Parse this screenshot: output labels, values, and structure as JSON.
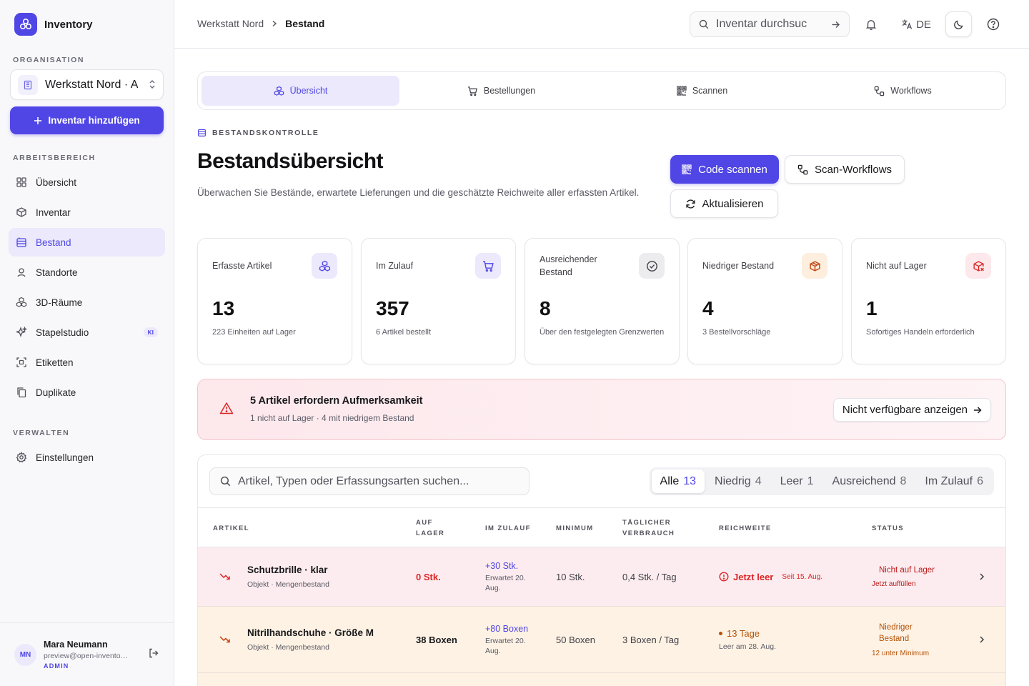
{
  "colors": {
    "accent": "#5046e5",
    "danger": "#dc2626",
    "warning": "#b45309"
  },
  "sidebar": {
    "app_name": "Inventory",
    "org_section": "ORGANISATION",
    "org_name": "Werkstatt Nord · A",
    "add_button": "Inventar hinzufügen",
    "workspace_section": "ARBEITSBEREICH",
    "workspace_items": [
      {
        "label": "Übersicht",
        "icon": "grid-icon"
      },
      {
        "label": "Inventar",
        "icon": "box-icon"
      },
      {
        "label": "Bestand",
        "icon": "stack-icon",
        "active": true
      },
      {
        "label": "Standorte",
        "icon": "location-pin-icon"
      },
      {
        "label": "3D-Räume",
        "icon": "cubes-icon"
      },
      {
        "label": "Stapelstudio",
        "icon": "sparkle-icon",
        "badge": "KI"
      },
      {
        "label": "Etiketten",
        "icon": "scan-frame-icon"
      },
      {
        "label": "Duplikate",
        "icon": "copy-icon"
      }
    ],
    "manage_section": "VERWALTEN",
    "manage_items": [
      {
        "label": "Einstellungen",
        "icon": "gear-icon"
      }
    ],
    "user": {
      "initials": "MN",
      "name": "Mara Neumann",
      "email": "preview@open-inventory.app",
      "role": "ADMIN"
    }
  },
  "header": {
    "breadcrumb": [
      "Werkstatt Nord",
      "Bestand"
    ],
    "search_placeholder": "Inventar durchsuc",
    "language": "DE"
  },
  "tabs": [
    {
      "label": "Übersicht",
      "icon": "cubes-icon",
      "active": true
    },
    {
      "label": "Bestellungen",
      "icon": "cart-icon"
    },
    {
      "label": "Scannen",
      "icon": "qr-code-icon"
    },
    {
      "label": "Workflows",
      "icon": "workflow-icon"
    }
  ],
  "page": {
    "eyebrow": "BESTANDSKONTROLLE",
    "title": "Bestandsübersicht",
    "description": "Überwachen Sie Bestände, erwartete Lieferungen und die geschätzte Reichweite aller erfassten Artikel.",
    "actions": {
      "scan": "Code scannen",
      "workflows": "Scan-Workflows",
      "refresh": "Aktualisieren"
    }
  },
  "stats": [
    {
      "label": "Erfasste Artikel",
      "value": "13",
      "sub": "223 Einheiten auf Lager",
      "icon": "cubes-icon"
    },
    {
      "label": "Im Zulauf",
      "value": "357",
      "sub": "6 Artikel bestellt",
      "icon": "cart-icon"
    },
    {
      "label": "Ausreichender Bestand",
      "value": "8",
      "sub": "Über den festgelegten Grenzwerten",
      "icon": "check-circle-icon"
    },
    {
      "label": "Niedriger Bestand",
      "value": "4",
      "sub": "3 Bestellvorschläge",
      "icon": "package-icon"
    },
    {
      "label": "Nicht auf Lager",
      "value": "1",
      "sub": "Sofortiges Handeln erforderlich",
      "icon": "package-x-icon"
    }
  ],
  "alert": {
    "title": "5 Artikel erfordern Aufmerksamkeit",
    "subtitle": "1 nicht auf Lager · 4 mit niedrigem Bestand",
    "button": "Nicht verfügbare anzeigen"
  },
  "table": {
    "search_placeholder": "Artikel, Typen oder Erfassungsarten suchen...",
    "filters": [
      {
        "label": "Alle",
        "count": "13",
        "active": true
      },
      {
        "label": "Niedrig",
        "count": "4"
      },
      {
        "label": "Leer",
        "count": "1"
      },
      {
        "label": "Ausreichend",
        "count": "8"
      },
      {
        "label": "Im Zulauf",
        "count": "6"
      }
    ],
    "columns": {
      "item": "ARTIKEL",
      "on_hand_1": "AUF",
      "on_hand_2": "LAGER",
      "incoming": "IM ZULAUF",
      "minimum": "MINIMUM",
      "daily_1": "TÄGLICHER",
      "daily_2": "VERBRAUCH",
      "reach": "REICHWEITE",
      "status": "STATUS"
    },
    "rows": [
      {
        "name": "Schutzbrille · klar",
        "meta": "Objekt · Mengenbestand",
        "on_hand": "0 Stk.",
        "incoming": "+30 Stk.",
        "incoming_date": "Erwartet 20. Aug.",
        "minimum": "10 Stk.",
        "daily": "0,4 Stk. / Tag",
        "reach": "Jetzt leer",
        "reach_sub": "Seit 15. Aug.",
        "status": "Nicht auf Lager",
        "status_sub": "Jetzt auffüllen"
      },
      {
        "name": "Nitrilhandschuhe · Größe M",
        "meta": "Objekt · Mengenbestand",
        "on_hand": "38 Boxen",
        "incoming": "+80 Boxen",
        "incoming_date": "Erwartet 20. Aug.",
        "minimum": "50 Boxen",
        "daily": "3 Boxen / Tag",
        "reach": "13 Tage",
        "reach_sub": "Leer am 28. Aug.",
        "status": "Niedriger Bestand",
        "status_sub": "12 unter Minimum"
      }
    ]
  }
}
